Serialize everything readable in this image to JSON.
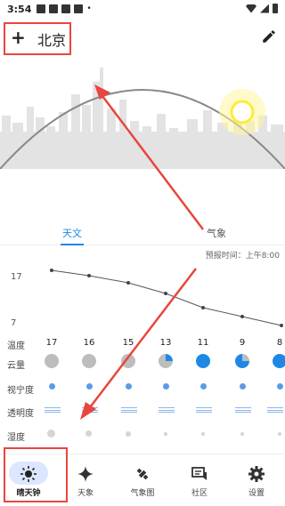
{
  "status": {
    "time": "3:54"
  },
  "header": {
    "city": "北京",
    "add_label": "+",
    "edit_icon": "pencil-icon"
  },
  "tabs": [
    {
      "label": "天文",
      "active": true
    },
    {
      "label": "气象",
      "active": false
    }
  ],
  "forecast_time": "预报时间：上午8:00",
  "temp_chart": {
    "max_label": "17",
    "min_label": "7"
  },
  "rows": {
    "temp": {
      "label": "温度",
      "values": [
        "17",
        "16",
        "15",
        "13",
        "11",
        "9",
        "8"
      ]
    },
    "cloud": {
      "label": "云量"
    },
    "seeing": {
      "label": "视宁度"
    },
    "transparency": {
      "label": "透明度"
    },
    "humidity": {
      "label": "湿度"
    }
  },
  "nav": [
    {
      "label": "晴天钟",
      "icon": "sun-icon",
      "active": true
    },
    {
      "label": "天象",
      "icon": "sparkle-icon",
      "active": false
    },
    {
      "label": "气象图",
      "icon": "satellite-icon",
      "active": false
    },
    {
      "label": "社区",
      "icon": "chat-icon",
      "active": false
    },
    {
      "label": "设置",
      "icon": "gear-icon",
      "active": false
    }
  ],
  "colors": {
    "accent": "#1e88e5",
    "highlight": "#e8463f",
    "sun": "#ffeb3b"
  }
}
